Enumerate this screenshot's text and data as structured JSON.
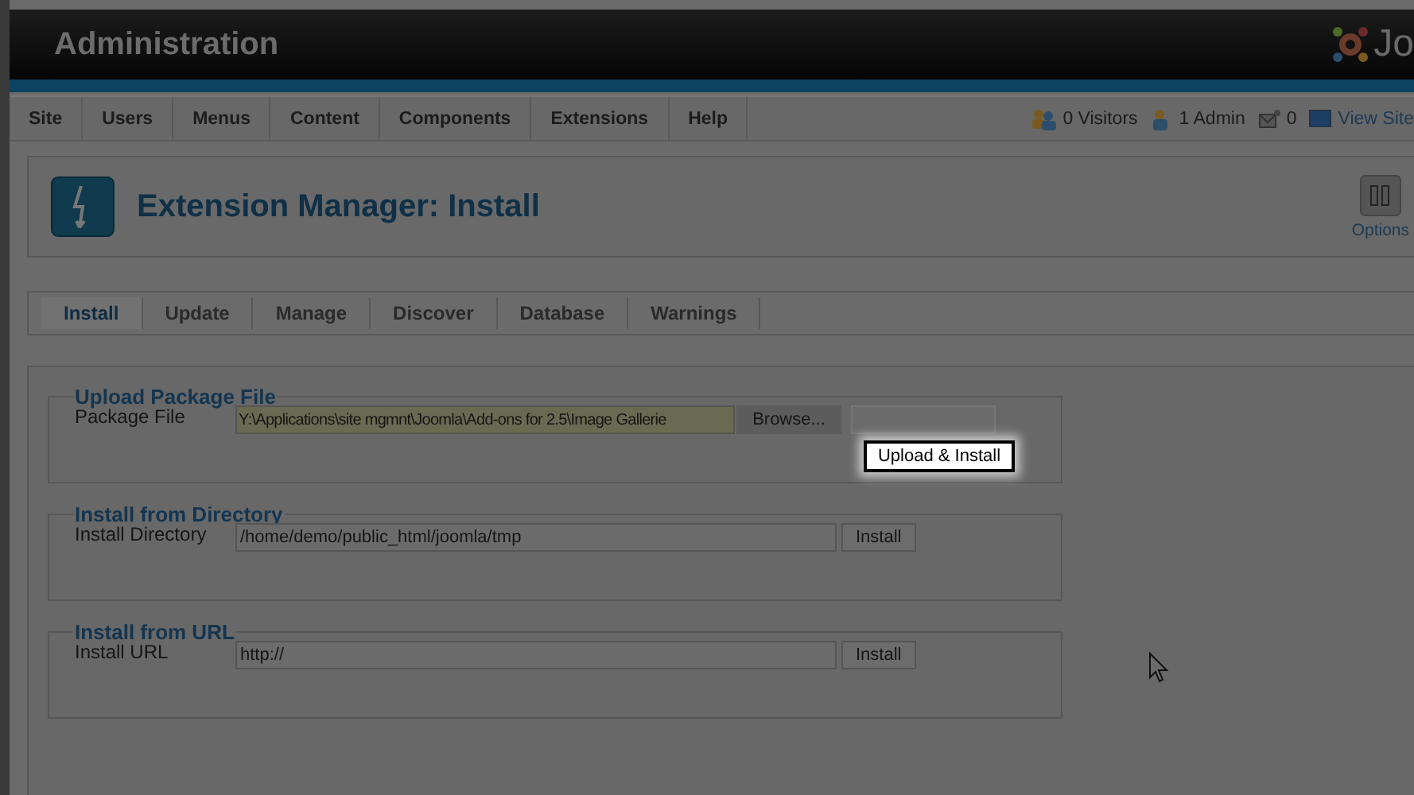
{
  "header": {
    "title": "Administration",
    "logo_text": "Jo"
  },
  "menu": [
    "Site",
    "Users",
    "Menus",
    "Content",
    "Components",
    "Extensions",
    "Help"
  ],
  "status": [
    {
      "kind": "users",
      "text": "0 Visitors"
    },
    {
      "kind": "user",
      "text": "1 Admin"
    },
    {
      "kind": "mail",
      "text": "0"
    },
    {
      "kind": "site",
      "text": "View Site"
    }
  ],
  "page_title": "Extension Manager: Install",
  "toolbar": [
    {
      "label": "Options"
    }
  ],
  "tabs": [
    {
      "label": "Install",
      "selected": true
    },
    {
      "label": "Update",
      "selected": false
    },
    {
      "label": "Manage",
      "selected": false
    },
    {
      "label": "Discover",
      "selected": false
    },
    {
      "label": "Database",
      "selected": false
    },
    {
      "label": "Warnings",
      "selected": false
    }
  ],
  "sections": [
    {
      "kind": "file",
      "legend": "Upload Package File",
      "label": "Package File",
      "value": "Y:\\Applications\\site mgmnt\\Joomla\\Add-ons for 2.5\\Image Gallerie",
      "browse": "Browse...",
      "tooltip": "Upload & Install"
    },
    {
      "kind": "text",
      "legend": "Install from Directory",
      "label": "Install Directory",
      "value": "/home/demo/public_html/joomla/tmp",
      "button": "Install"
    },
    {
      "kind": "text",
      "legend": "Install from URL",
      "label": "Install URL",
      "value": "http://",
      "button": "Install"
    }
  ]
}
